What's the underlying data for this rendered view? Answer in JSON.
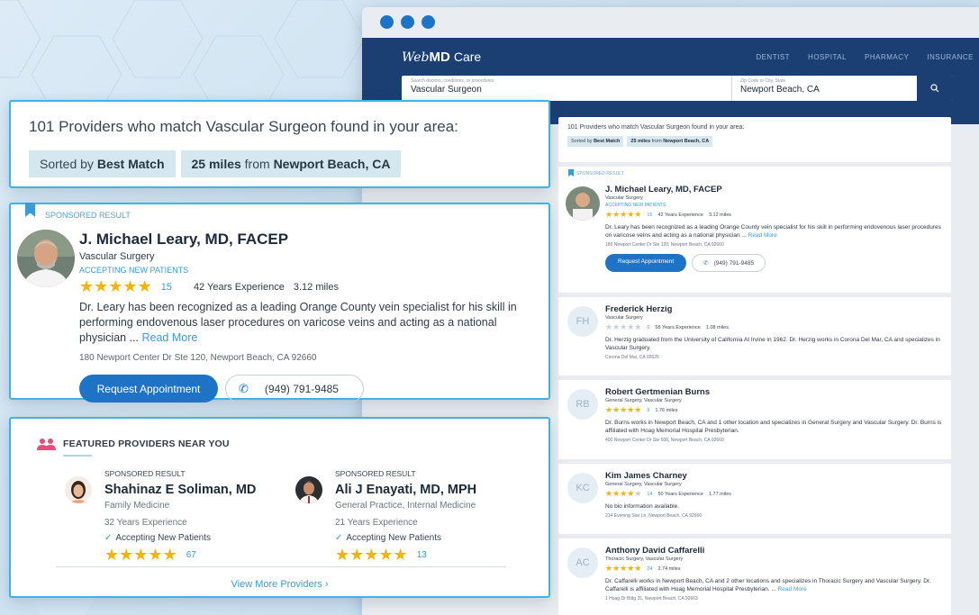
{
  "browser": {
    "brand": {
      "web": "Web",
      "md": "MD",
      "care": "Care"
    },
    "nav": [
      "DENTIST",
      "HOSPITAL",
      "PHARMACY",
      "INSURANCE"
    ],
    "search": {
      "query_placeholder": "Search doctors, conditions, or procedures",
      "query_value": "Vascular Surgeon",
      "location_placeholder": "Zip Code or City, State",
      "location_value": "Newport Beach, CA"
    },
    "results_title": "101 Providers who match Vascular Surgeon found in your area:",
    "chip_sort": {
      "prefix": "Sorted by ",
      "value": "Best Match"
    },
    "chip_dist": {
      "value": "25 miles",
      "mid": " from ",
      "place": "Newport Beach, CA"
    },
    "cards": [
      {
        "sponsored": "SPONSORED RESULT",
        "name": "J. Michael Leary, MD, FACEP",
        "specialty": "Vascular Surgery",
        "accepting": "ACCEPTING NEW PATIENTS",
        "rating": 4.5,
        "stars_on": "★★★★★",
        "stars_off": "",
        "reviews": "15",
        "experience": "42 Years Experience",
        "distance": "3.12 miles",
        "bio": "Dr. Leary has been recognized as a leading Orange County vein specialist for his skill in performing endovenous laser procedures on varicose veins and acting as a national physician ...",
        "read_more": "Read More",
        "address": "180 Newport Center Dr Ste 120, Newport Beach, CA 92660",
        "request": "Request Appointment",
        "phone": "(949) 791-9485"
      },
      {
        "initials": "FH",
        "name": "Frederick Herzig",
        "specialty": "Vascular Surgery",
        "stars_on": "",
        "stars_off": "★★★★★",
        "reviews": "0",
        "experience": "58 Years Experience",
        "distance": "1.08 miles",
        "bio": "Dr. Herzig graduated from the University of California At Irvine in 1962. Dr. Herzig works in Corona Del Mar, CA and specializes in Vascular Surgery.",
        "address": "Corona Del Mar, CA 92625"
      },
      {
        "initials": "RB",
        "name": "Robert Gertmenian Burns",
        "specialty": "General Surgery, Vascular Surgery",
        "stars_on": "★★★★★",
        "stars_off": "",
        "reviews": "9",
        "distance": "1.76 miles",
        "bio": "Dr. Burns works in Newport Beach, CA and 1 other location and specializes in General Surgery and Vascular Surgery. Dr. Burns is affiliated with Hoag Memorial Hospital Presbyterian.",
        "address": "400 Newport Center Dr Ste 500, Newport Beach, CA 92660"
      },
      {
        "initials": "KC",
        "name": "Kim James Charney",
        "specialty": "General Surgery, Vascular Surgery",
        "stars_on": "★★★★",
        "stars_off": "★",
        "reviews": "14",
        "experience": "50 Years Experience",
        "distance": "1.77 miles",
        "bio": "No bio information available.",
        "address": "214 Evening Star Ln, Newport Beach, CA 92660"
      },
      {
        "initials": "AC",
        "name": "Anthony David Caffarelli",
        "specialty": "Thoracic Surgery, Vascular Surgery",
        "stars_on": "★★★★★",
        "stars_off": "",
        "reviews": "24",
        "distance": "2.74 miles",
        "bio": "Dr. Caffarelli works in Newport Beach, CA and 2 other locations and specializes in Thoracic Surgery and Vascular Surgery. Dr. Caffarelli is affiliated with Hoag Memorial Hospital Presbyterian. ...",
        "read_more": "Read More",
        "address": "1 Hoag Dr Bldg 31, Newport Beach, CA 92663"
      }
    ]
  },
  "zoom_header": {
    "title": "101 Providers who match Vascular Surgeon found in your area:",
    "sort_prefix": "Sorted by ",
    "sort_value": "Best Match",
    "dist_value": "25 miles",
    "dist_mid": " from ",
    "dist_place": "Newport Beach, CA"
  },
  "zoom_card": {
    "sponsored": "SPONSORED RESULT",
    "name": "J. Michael Leary, MD, FACEP",
    "specialty": "Vascular Surgery",
    "accepting": "ACCEPTING NEW PATIENTS",
    "stars_on": "★★★★★",
    "reviews": "15",
    "experience": "42 Years Experience",
    "distance": "3.12 miles",
    "bio": "Dr. Leary has been recognized as a leading Orange County vein specialist for his skill in performing endovenous laser procedures on varicose veins and acting as a national physician ...",
    "read_more": "Read More",
    "address": "180 Newport Center Dr Ste 120, Newport Beach, CA 92660",
    "request": "Request Appointment",
    "phone": "(949) 791-9485"
  },
  "featured": {
    "title": "FEATURED PROVIDERS NEAR YOU",
    "providers": [
      {
        "sponsored": "SPONSORED RESULT",
        "name": "Shahinaz E Soliman, MD",
        "specialty": "Family Medicine",
        "experience": "32 Years Experience",
        "accepting": "Accepting New Patients",
        "stars_on": "★★★★★",
        "reviews": "67"
      },
      {
        "sponsored": "SPONSORED RESULT",
        "name": "Ali J Enayati, MD, MPH",
        "specialty": "General Practice, Internal Medicine",
        "experience": "21 Years Experience",
        "accepting": "Accepting New Patients",
        "stars_on": "★★★★★",
        "reviews": "13"
      }
    ],
    "view_more": "View More Providers ›"
  },
  "colors": {
    "brand_blue": "#1b3f73",
    "accent": "#3a9bd8",
    "button": "#1f73c7",
    "star": "#f5b301",
    "panel_border": "#3cb4e6"
  }
}
